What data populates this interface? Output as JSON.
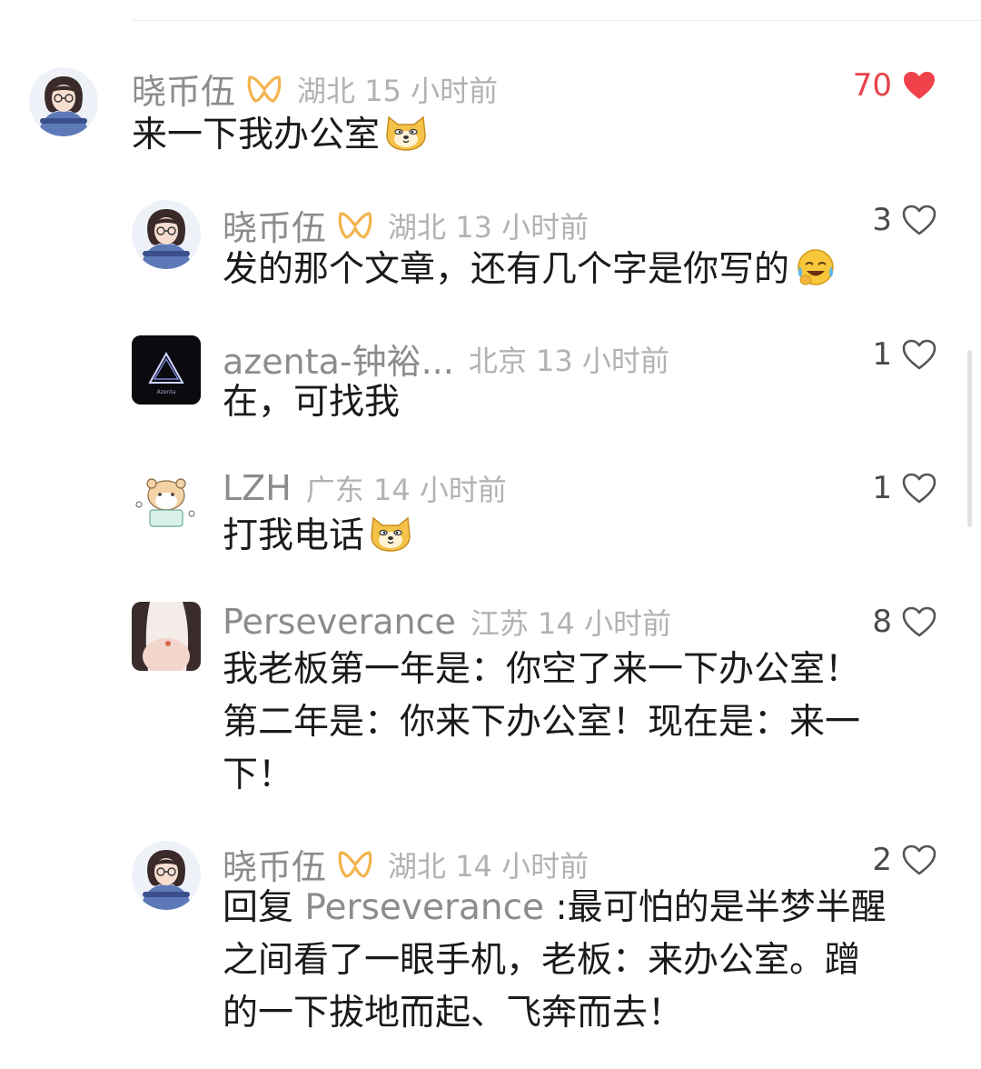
{
  "comments": [
    {
      "user": "晓币伍",
      "location_time": "湖北 15 小时前",
      "likes": "70",
      "liked": true,
      "lines": [
        "来一下我办公室"
      ],
      "emoji": "cat-face-emoji"
    },
    {
      "user": "晓币伍",
      "location_time": "湖北 13 小时前",
      "likes": "3",
      "liked": false,
      "lines": [
        "发的那个文章，还有几个字是你写的"
      ],
      "emoji": "crying-laughing-emoji"
    },
    {
      "user": "azenta-钟裕...",
      "location_time": "北京 13 小时前",
      "likes": "1",
      "liked": false,
      "lines": [
        "在，可找我"
      ],
      "avatar_text": "Azenta"
    },
    {
      "user": "LZH",
      "location_time": "广东 14 小时前",
      "likes": "1",
      "liked": false,
      "lines": [
        "打我电话"
      ],
      "emoji": "cat-face-emoji"
    },
    {
      "user": "Perseverance",
      "location_time": "江苏 14 小时前",
      "likes": "8",
      "liked": false,
      "lines": [
        "我老板第一年是：你空了来一下办公室！",
        "第二年是：你来下办公室！现在是：来一",
        "下！"
      ]
    },
    {
      "user": "晓币伍",
      "location_time": "湖北 14 小时前",
      "likes": "2",
      "liked": false,
      "reply_prefix": "回复 ",
      "reply_to": "Perseverance",
      "lines": [
        " :最可怕的是半梦半醒",
        "之间看了一眼手机，老板：来办公室。蹭",
        "的一下拔地而起、飞奔而去！"
      ]
    }
  ],
  "colors": {
    "heart_liked": "#f0424a",
    "like_count_liked": "#e6424a",
    "badge": "#f3b34d"
  }
}
